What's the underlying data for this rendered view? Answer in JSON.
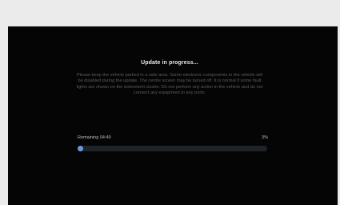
{
  "update": {
    "title": "Update in progress...",
    "description": "Please keep the vehicle parked in a safe area. Some electronic components in the vehicle will be disabled during the update. The centre screen may be turned off. It is normal if some fault lights are shown on the instrument cluster. Do not perform any action in the vehicle and do not connect any equipment to any ports.",
    "remaining_label": "Remaining 04:49",
    "percent_label": "3%",
    "progress_fraction": 0.03
  },
  "colors": {
    "background": "#050505",
    "accent": "#4a78c2"
  }
}
